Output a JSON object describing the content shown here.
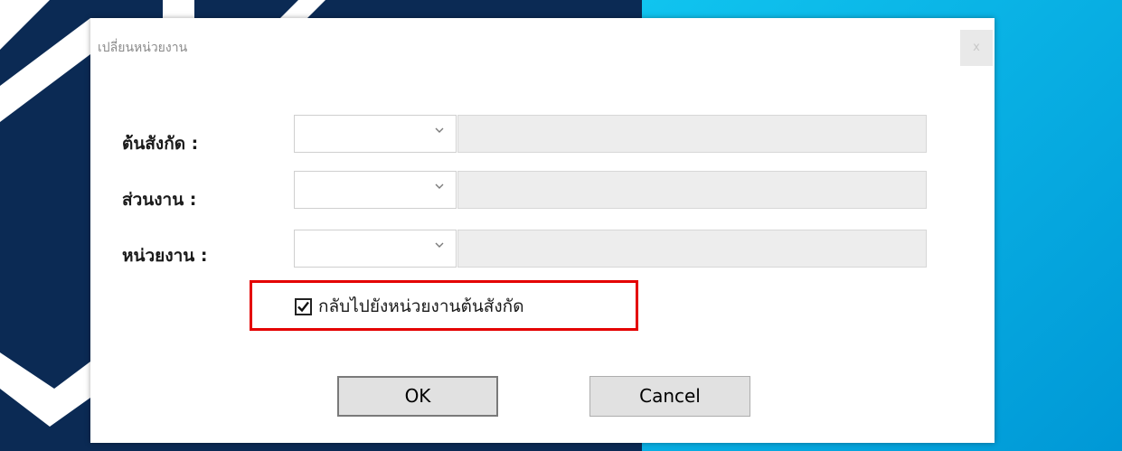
{
  "dialog": {
    "title": "เปลี่ยนหน่วยงาน",
    "close_label": "x"
  },
  "form": {
    "rows": [
      {
        "label": "ต้นสังกัด :",
        "selected_value": "",
        "description": ""
      },
      {
        "label": "ส่วนงาน :",
        "selected_value": "",
        "description": ""
      },
      {
        "label": "หน่วยงาน :",
        "selected_value": "",
        "description": ""
      }
    ],
    "checkbox": {
      "label": "กลับไปยังหน่วยงานต้นสังกัด",
      "checked": true
    }
  },
  "buttons": {
    "ok_label": "OK",
    "cancel_label": "Cancel"
  },
  "colors": {
    "highlight_border": "#e40000",
    "backdrop_navy": "#0b2a54",
    "backdrop_cyan": "#00b4e6"
  },
  "icons": {
    "close": "close-icon",
    "dropdown": "chevron-down-icon",
    "check": "checkmark-icon"
  }
}
